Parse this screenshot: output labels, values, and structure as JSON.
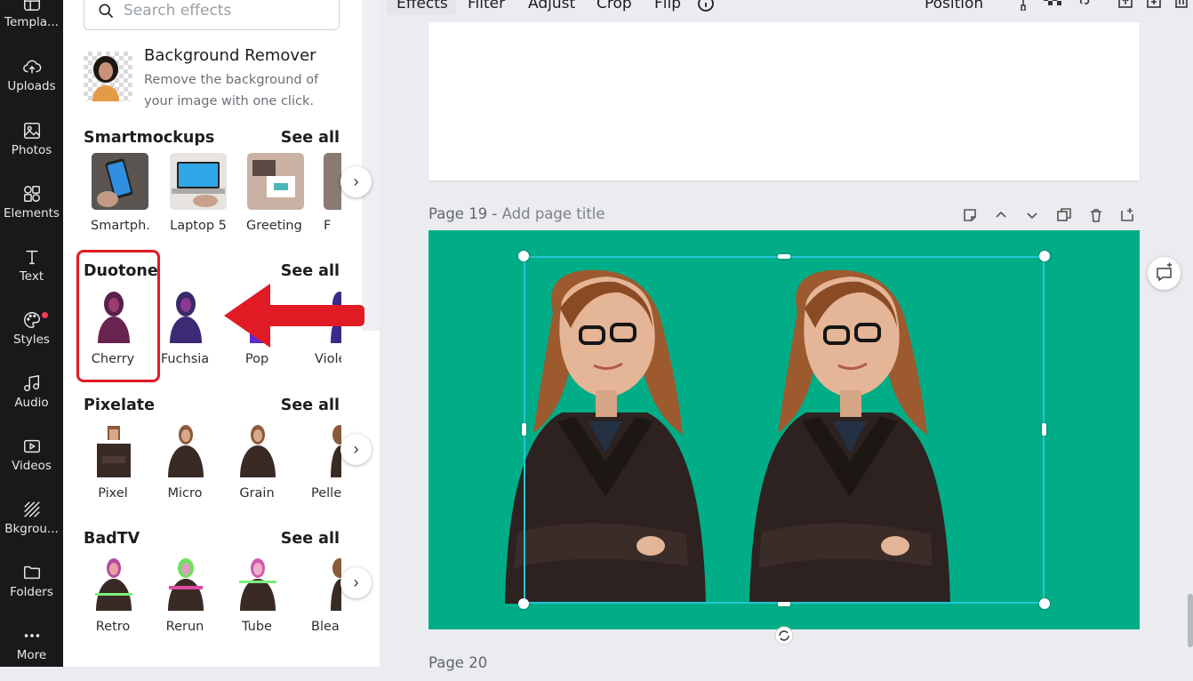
{
  "rail": [
    {
      "label": "Templa...",
      "icon": "templates-icon"
    },
    {
      "label": "Uploads",
      "icon": "upload-cloud-icon"
    },
    {
      "label": "Photos",
      "icon": "photo-icon"
    },
    {
      "label": "Elements",
      "icon": "shapes-icon"
    },
    {
      "label": "Text",
      "icon": "text-icon"
    },
    {
      "label": "Styles",
      "icon": "palette-icon"
    },
    {
      "label": "Audio",
      "icon": "music-note-icon"
    },
    {
      "label": "Videos",
      "icon": "video-icon"
    },
    {
      "label": "Bkgrou...",
      "icon": "background-icon"
    },
    {
      "label": "Folders",
      "icon": "folder-icon"
    },
    {
      "label": "More",
      "icon": "more-dots-icon"
    }
  ],
  "search": {
    "placeholder": "Search effects"
  },
  "remover": {
    "title": "Background Remover",
    "description": "Remove the background of your image with one click."
  },
  "sections": [
    {
      "title": "Smartmockups",
      "see_all": "See all",
      "items": [
        "Smartph...",
        "Laptop 5",
        "Greeting ...",
        "F"
      ]
    },
    {
      "title": "Duotone",
      "see_all": "See all",
      "items": [
        "Cherry",
        "Fuchsia",
        "Pop",
        "Viole"
      ]
    },
    {
      "title": "Pixelate",
      "see_all": "See all",
      "items": [
        "Pixel",
        "Micro",
        "Grain",
        "Pelle"
      ]
    },
    {
      "title": "BadTV",
      "see_all": "See all",
      "items": [
        "Retro",
        "Rerun",
        "Tube",
        "Blea"
      ]
    }
  ],
  "toolbar": {
    "effects": "Effects",
    "filter": "Filter",
    "adjust": "Adjust",
    "crop": "Crop",
    "flip": "Flip",
    "position": "Position"
  },
  "canvas": {
    "page19_label": "Page 19 -",
    "page19_title_placeholder": "Add page title",
    "page20_label": "Page 20",
    "background_color": "#00ad87"
  },
  "annotation": {
    "highlight_color": "#e01b24"
  }
}
